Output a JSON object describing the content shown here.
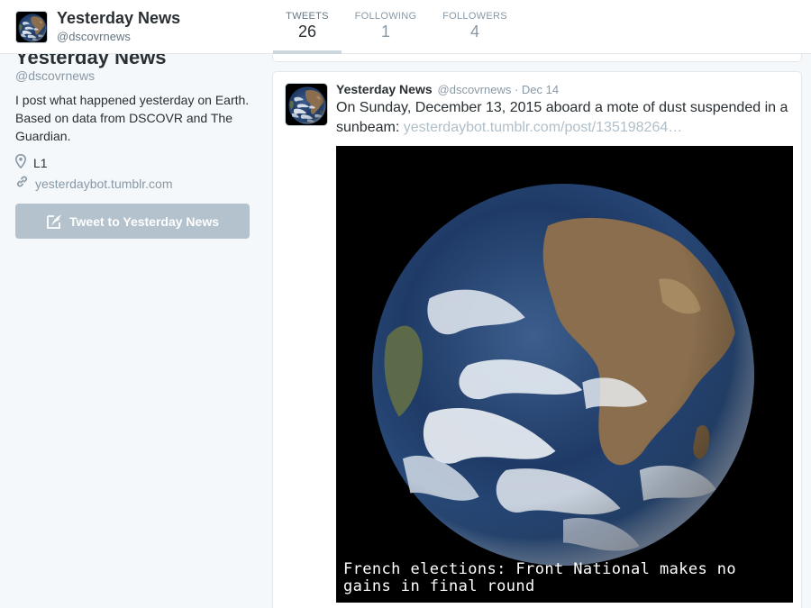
{
  "profile": {
    "name": "Yesterday News",
    "handle": "@dscovrnews",
    "bio": "I post what happened yesterday on Earth. Based on data from DSCOVR and The Guardian.",
    "location": "L1",
    "url": "yesterdaybot.tumblr.com",
    "tweet_to_label": "Tweet to Yesterday News"
  },
  "nav": {
    "tweets_label": "TWEETS",
    "tweets_count": "26",
    "following_label": "FOLLOWING",
    "following_count": "1",
    "followers_label": "FOLLOWERS",
    "followers_count": "4"
  },
  "tweet": {
    "name": "Yesterday News",
    "handle": "@dscovrnews",
    "separator": " · ",
    "date": "Dec 14",
    "text": "On Sunday, December 13, 2015 aboard a mote of dust suspended in a sunbeam: ",
    "link": "yesterdaybot.tumblr.com/post/135198264…",
    "media_caption": "French elections: Front National makes no gains in final round"
  },
  "icons": {
    "location": "map-pin-icon",
    "url": "link-icon",
    "compose": "compose-tweet-icon"
  },
  "colors": {
    "background": "#f5f8fa",
    "muted": "#8899a6",
    "button": "#b3c2cc"
  }
}
